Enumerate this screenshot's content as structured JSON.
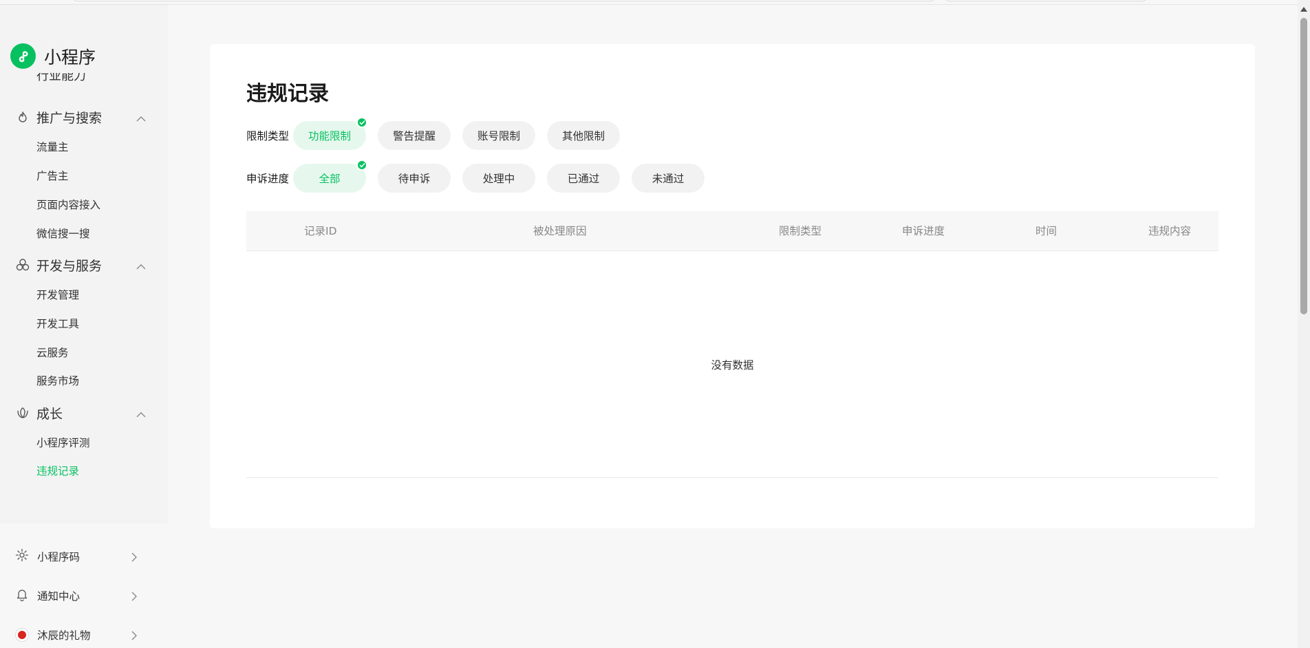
{
  "app": {
    "title": "小程序"
  },
  "sidebar": {
    "clipped_item": "行业能力",
    "groups": [
      {
        "label": "推广与搜索",
        "icon": "flame-icon",
        "items": [
          "流量主",
          "广告主",
          "页面内容接入",
          "微信搜一搜"
        ]
      },
      {
        "label": "开发与服务",
        "icon": "cluster-icon",
        "items": [
          "开发管理",
          "开发工具",
          "云服务",
          "服务市场"
        ]
      },
      {
        "label": "成长",
        "icon": "growth-icon",
        "items": [
          "小程序评测",
          "违规记录"
        ]
      }
    ],
    "active_item": "违规记录",
    "bottom": [
      {
        "label": "小程序码",
        "icon": "sun-icon"
      },
      {
        "label": "通知中心",
        "icon": "bell-icon"
      },
      {
        "label": "沐辰的礼物",
        "icon": "avatar"
      }
    ]
  },
  "main": {
    "title": "违规记录",
    "filters": {
      "restriction_type": {
        "label": "限制类型",
        "options": [
          "功能限制",
          "警告提醒",
          "账号限制",
          "其他限制"
        ],
        "selected": "功能限制"
      },
      "appeal_progress": {
        "label": "申诉进度",
        "options": [
          "全部",
          "待申诉",
          "处理中",
          "已通过",
          "未通过"
        ],
        "selected": "全部"
      }
    },
    "table": {
      "columns": [
        "记录ID",
        "被处理原因",
        "限制类型",
        "申诉进度",
        "时间",
        "违规内容"
      ],
      "rows": [],
      "empty_text": "没有数据"
    }
  },
  "colors": {
    "accent": "#07c160",
    "chip_selected_bg": "#e6f8ee",
    "page_bg": "#f7f7f8"
  }
}
